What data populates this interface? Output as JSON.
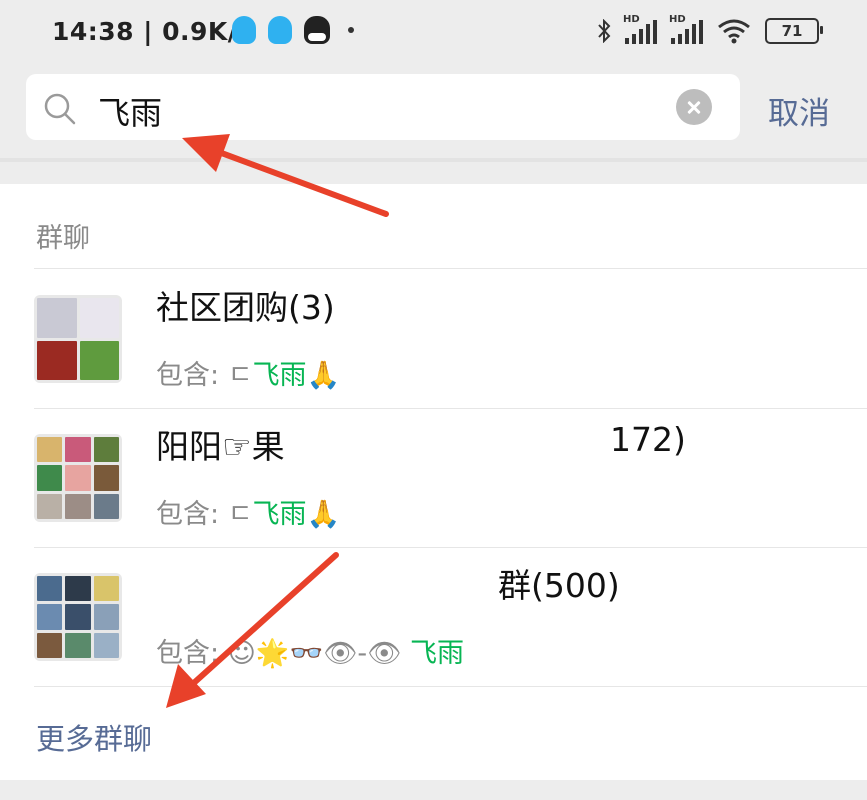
{
  "status_bar": {
    "time_speed": "14:38 | 0.9K/s",
    "hd1": "HD",
    "hd2": "HD",
    "battery": "71"
  },
  "search": {
    "query": "飞雨",
    "cancel_label": "取消"
  },
  "section": {
    "title": "群聊"
  },
  "results": [
    {
      "title": "社区团购(3)",
      "sub_prefix": "包含: ",
      "sub_nick": "ㄷ",
      "sub_match": "飞雨",
      "sub_suffix": "🙏"
    },
    {
      "title": "阳阳☞果",
      "title_tail": "172)",
      "sub_prefix": "包含: ",
      "sub_nick": "ㄷ",
      "sub_match": "飞雨",
      "sub_suffix": "🙏"
    },
    {
      "title_tail": "群(500)",
      "sub_prefix": "包含: ",
      "sub_nick": "☺🌟👓👁-👁",
      "sub_match": "飞雨"
    }
  ],
  "more_label": "更多群聊",
  "colors": {
    "background": "#ededed",
    "link": "#576b95",
    "highlight": "#07b553",
    "arrow": "#e8412a"
  },
  "icons": [
    "qq-icon",
    "qq-icon",
    "qq-penguin-icon",
    "bluetooth-icon",
    "signal-icon",
    "wifi-icon",
    "battery-icon",
    "search-icon",
    "clear-icon",
    "arrow-annotation"
  ]
}
